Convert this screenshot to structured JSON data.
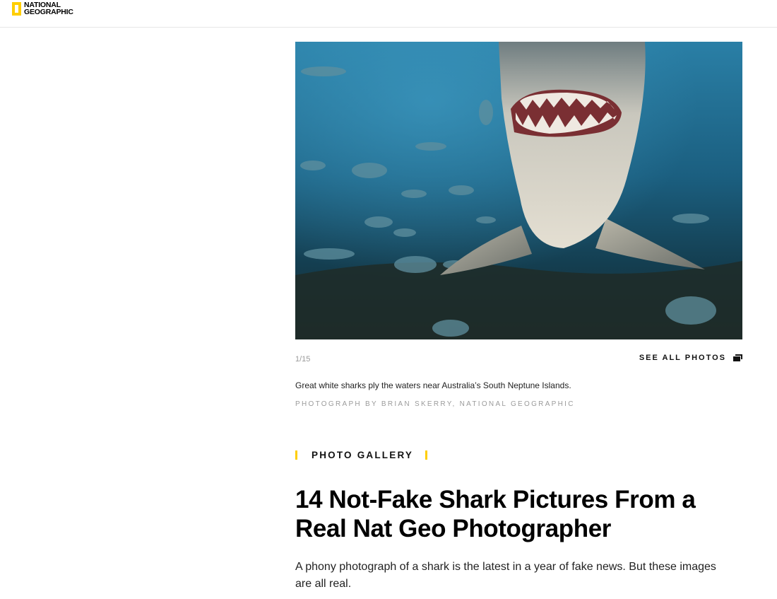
{
  "header": {
    "logo_line1": "NATIONAL",
    "logo_line2": "GEOGRAPHIC",
    "brand_color": "#ffce00"
  },
  "gallery": {
    "counter": "1/15",
    "see_all_label": "SEE ALL PHOTOS",
    "see_all_icon": "gallery-stack-icon",
    "caption": "Great white sharks ply the waters near Australia’s South Neptune Islands.",
    "credit": "PHOTOGRAPH BY BRIAN SKERRY, NATIONAL GEOGRAPHIC"
  },
  "article": {
    "kicker": "PHOTO GALLERY",
    "headline": "14 Not-Fake Shark Pictures From a Real Nat Geo Photographer",
    "dek": "A phony photograph of a shark is the latest in a year of fake news. But these images are all real.",
    "accent_color": "#ffce00"
  }
}
